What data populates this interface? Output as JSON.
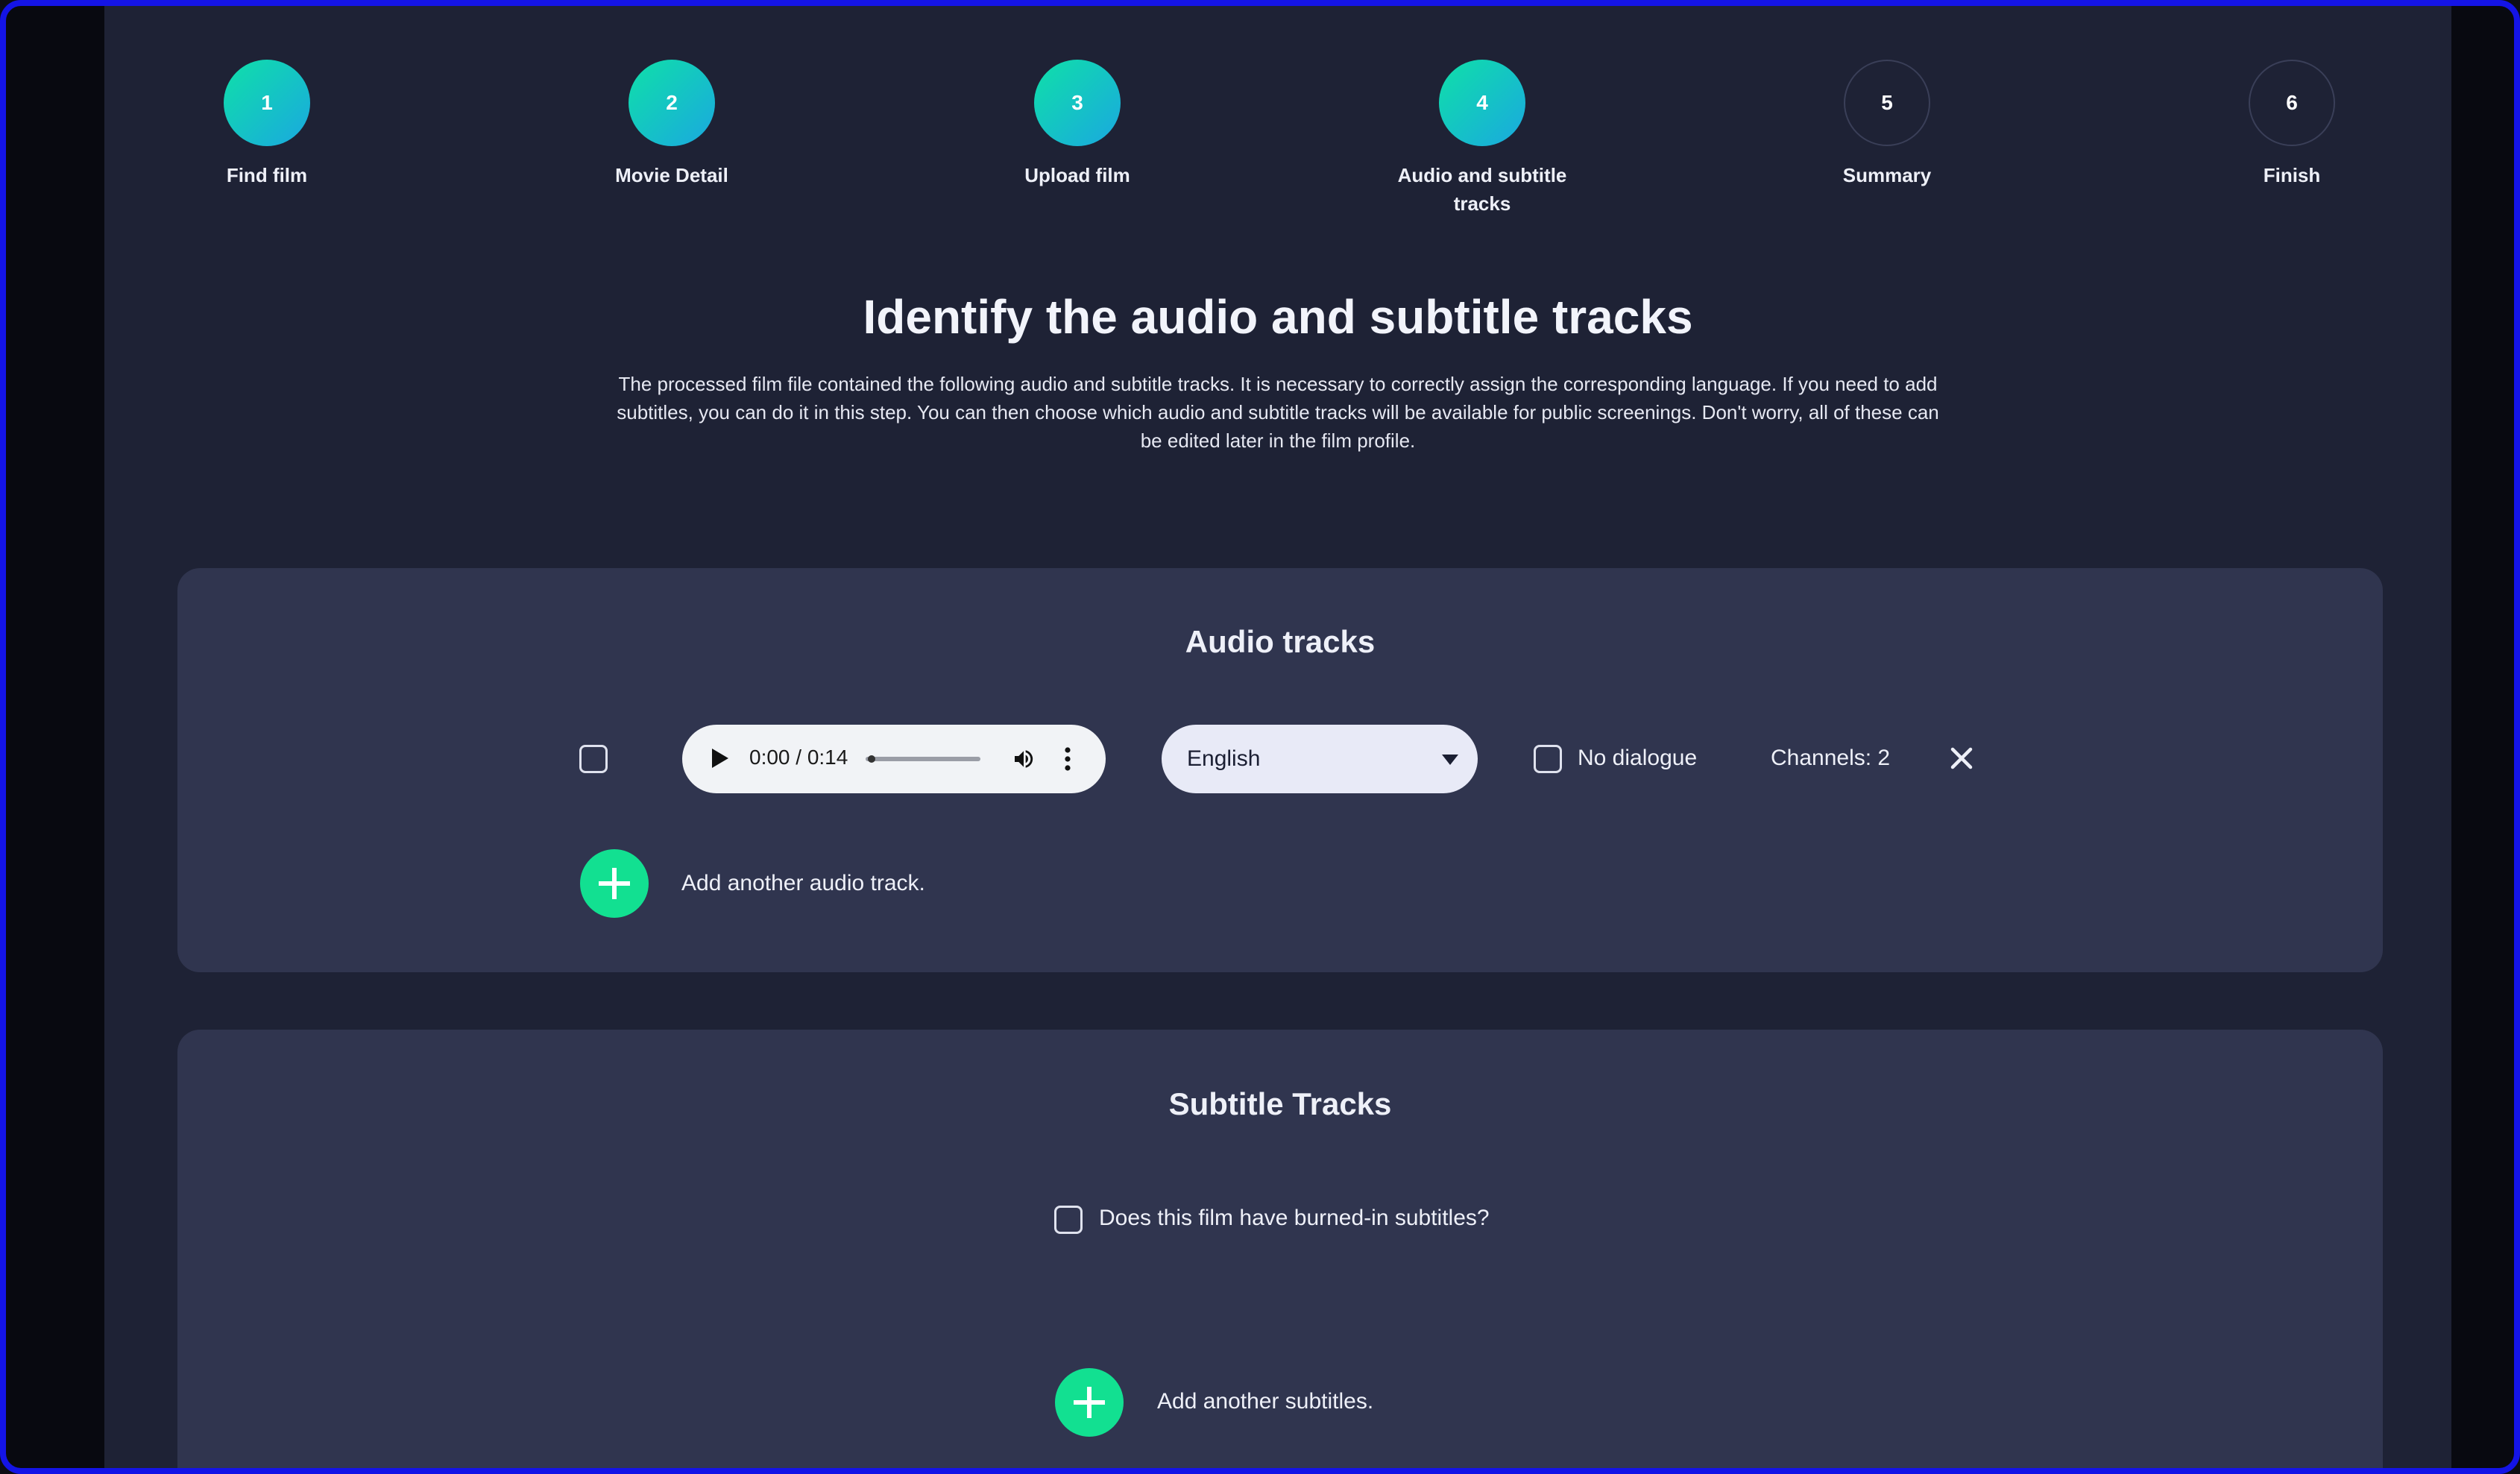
{
  "stepper": {
    "steps": [
      {
        "number": "1",
        "label": "Find film",
        "status": "done"
      },
      {
        "number": "2",
        "label": "Movie Detail",
        "status": "done"
      },
      {
        "number": "3",
        "label": "Upload film",
        "status": "done"
      },
      {
        "number": "4",
        "label": "Audio and subtitle tracks",
        "status": "current"
      },
      {
        "number": "5",
        "label": "Summary",
        "status": "todo"
      },
      {
        "number": "6",
        "label": "Finish",
        "status": "todo"
      }
    ]
  },
  "page": {
    "title": "Identify the audio and subtitle tracks",
    "description": "The processed film file contained the following audio and subtitle tracks. It is necessary to correctly assign the corresponding language. If you need to add subtitles, you can do it in this step. You can then choose which audio and subtitle tracks will be available for public screenings. Don't worry, all of these can be edited later in the film profile."
  },
  "audio": {
    "title": "Audio tracks",
    "track": {
      "time": "0:00 / 0:14",
      "progress": 0.02,
      "language": "English",
      "no_dialogue_label": "No dialogue",
      "channels": "Channels: 2"
    },
    "add_label": "Add another audio track."
  },
  "subtitles": {
    "title": "Subtitle Tracks",
    "burned_in_label": "Does this film have burned-in subtitles?",
    "add_label": "Add another subtitles."
  },
  "colors": {
    "accent_green": "#12e091",
    "accent_gradient_start": "#0fe0a8",
    "accent_gradient_end": "#1aa8e0",
    "card_bg": "#30354f",
    "page_bg": "#1e2235",
    "frame_border": "#1414e6"
  },
  "icons": [
    "play-icon",
    "volume-icon",
    "more-vert-icon",
    "chevron-down-icon",
    "close-icon",
    "plus-icon"
  ]
}
